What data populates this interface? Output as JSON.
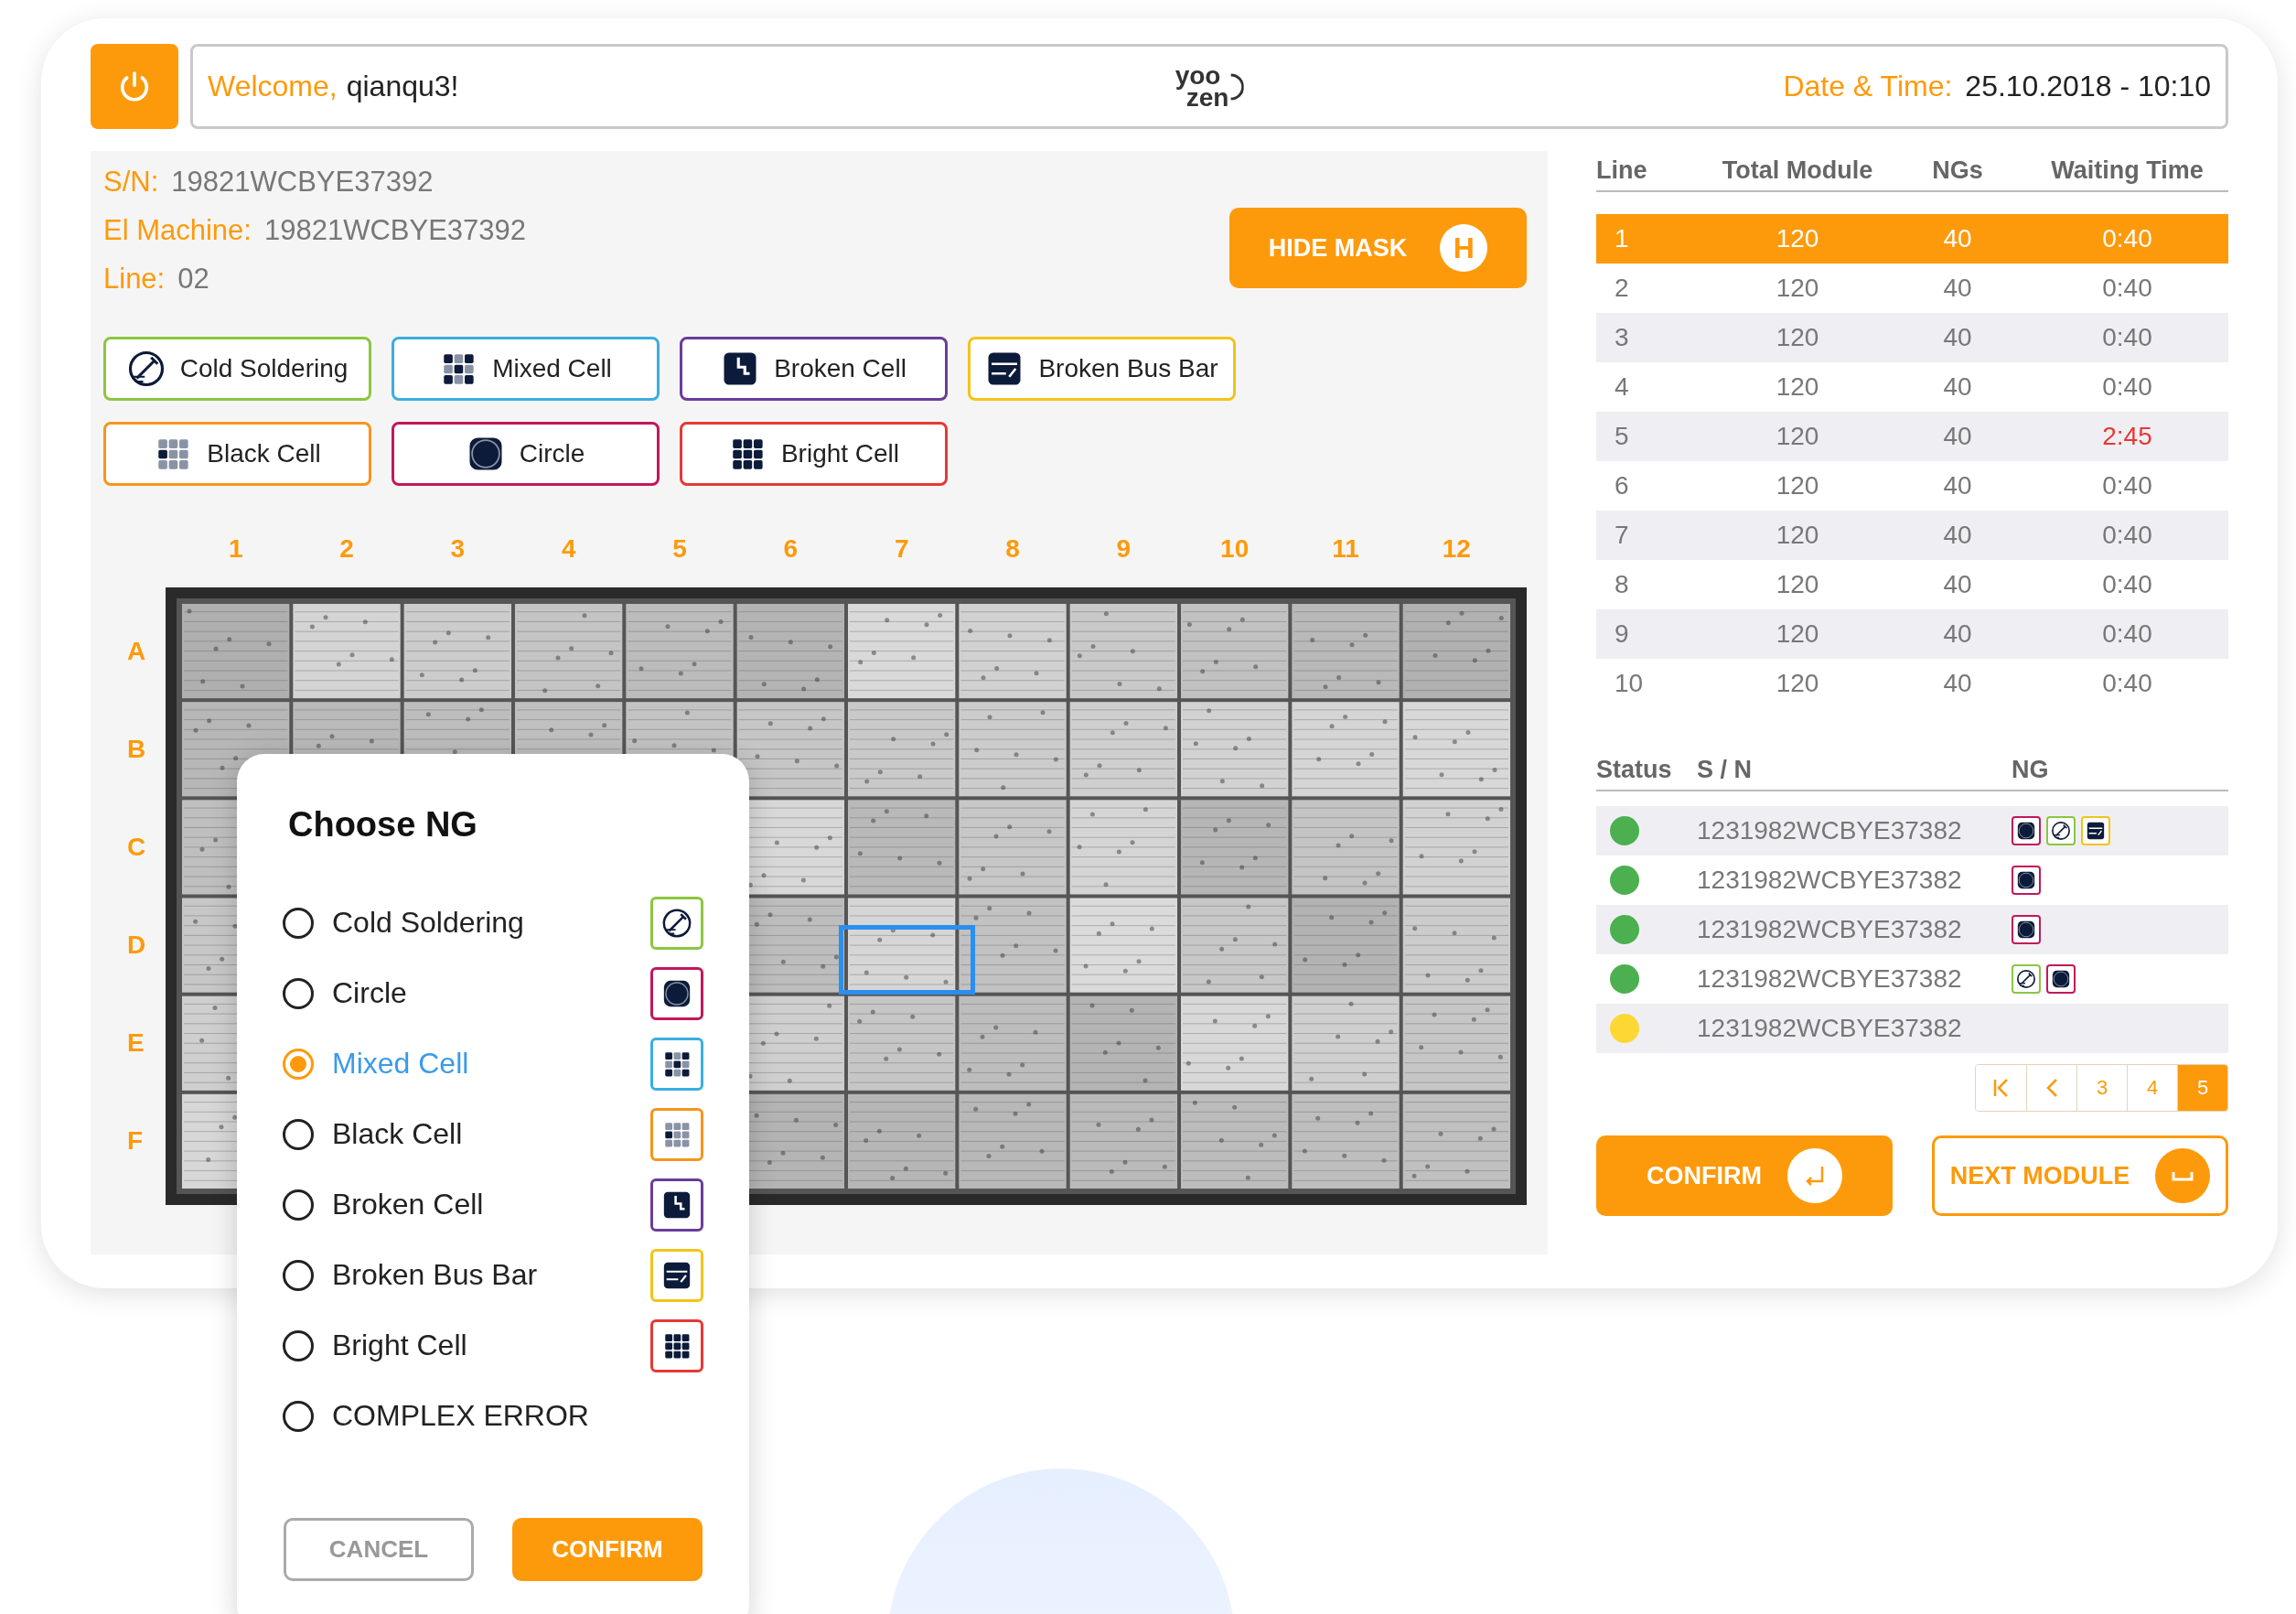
{
  "header": {
    "welcome_label": "Welcome,",
    "user": "qianqu3!",
    "logo_top": "yoo",
    "logo_bottom": "zen",
    "datetime_label": "Date & Time:",
    "datetime": "25.10.2018 - 10:10"
  },
  "info": [
    {
      "label": "S/N:",
      "value": "19821WCBYE37392"
    },
    {
      "label": "El Machine:",
      "value": "19821WCBYE37392"
    },
    {
      "label": "Line:",
      "value": "02"
    }
  ],
  "hide_mask": {
    "label": "HIDE MASK",
    "key": "H"
  },
  "defect_types": [
    {
      "kind": "cold-soldering",
      "label": "Cold Soldering",
      "color": "#8cc63f"
    },
    {
      "kind": "mixed-cell",
      "label": "Mixed Cell",
      "color": "#3aaee0"
    },
    {
      "kind": "broken-cell",
      "label": "Broken Cell",
      "color": "#6a3d9a"
    },
    {
      "kind": "broken-bus-bar",
      "label": "Broken Bus Bar",
      "color": "#f2c418"
    },
    {
      "kind": "black-cell",
      "label": "Black Cell",
      "color": "#f7941d"
    },
    {
      "kind": "circle",
      "label": "Circle",
      "color": "#c2185b"
    },
    {
      "kind": "bright-cell",
      "label": "Bright Cell",
      "color": "#e53935"
    }
  ],
  "grid": {
    "columns": [
      "1",
      "2",
      "3",
      "4",
      "5",
      "6",
      "7",
      "8",
      "9",
      "10",
      "11",
      "12"
    ],
    "rows": [
      "A",
      "B",
      "C",
      "D",
      "E",
      "F"
    ]
  },
  "lines_table": {
    "columns": [
      "Line",
      "Total Module",
      "NGs",
      "Waiting Time"
    ],
    "rows": [
      {
        "line": "1",
        "total": "120",
        "ngs": "40",
        "waiting": "0:40",
        "selected": true,
        "late": false
      },
      {
        "line": "2",
        "total": "120",
        "ngs": "40",
        "waiting": "0:40",
        "selected": false,
        "late": false
      },
      {
        "line": "3",
        "total": "120",
        "ngs": "40",
        "waiting": "0:40",
        "selected": false,
        "late": false
      },
      {
        "line": "4",
        "total": "120",
        "ngs": "40",
        "waiting": "0:40",
        "selected": false,
        "late": false
      },
      {
        "line": "5",
        "total": "120",
        "ngs": "40",
        "waiting": "2:45",
        "selected": false,
        "late": true
      },
      {
        "line": "6",
        "total": "120",
        "ngs": "40",
        "waiting": "0:40",
        "selected": false,
        "late": false
      },
      {
        "line": "7",
        "total": "120",
        "ngs": "40",
        "waiting": "0:40",
        "selected": false,
        "late": false
      },
      {
        "line": "8",
        "total": "120",
        "ngs": "40",
        "waiting": "0:40",
        "selected": false,
        "late": false
      },
      {
        "line": "9",
        "total": "120",
        "ngs": "40",
        "waiting": "0:40",
        "selected": false,
        "late": false
      },
      {
        "line": "10",
        "total": "120",
        "ngs": "40",
        "waiting": "0:40",
        "selected": false,
        "late": false
      }
    ]
  },
  "modules_table": {
    "columns": [
      "Status",
      "S / N",
      "NG"
    ],
    "rows": [
      {
        "color": "#4caf50",
        "sn": "1231982WCBYE37382",
        "ngs": [
          {
            "kind": "circle"
          },
          {
            "kind": "cold-soldering"
          },
          {
            "kind": "broken-bus-bar"
          }
        ]
      },
      {
        "color": "#4caf50",
        "sn": "1231982WCBYE37382",
        "ngs": [
          {
            "kind": "circle"
          }
        ]
      },
      {
        "color": "#4caf50",
        "sn": "1231982WCBYE37382",
        "ngs": [
          {
            "kind": "circle"
          }
        ]
      },
      {
        "color": "#4caf50",
        "sn": "1231982WCBYE37382",
        "ngs": [
          {
            "kind": "cold-soldering"
          },
          {
            "kind": "circle"
          }
        ]
      },
      {
        "color": "#fdd835",
        "sn": "1231982WCBYE37382",
        "ngs": []
      }
    ]
  },
  "pagination": [
    {
      "label": "3",
      "selected": false
    },
    {
      "label": "4",
      "selected": false
    },
    {
      "label": "5",
      "selected": true
    }
  ],
  "actions": {
    "confirm": "CONFIRM",
    "next": "NEXT MODULE"
  },
  "dialog": {
    "title": "Choose NG",
    "options": [
      {
        "kind": "cold-soldering",
        "label": "Cold Soldering",
        "selected": false
      },
      {
        "kind": "circle",
        "label": "Circle",
        "selected": false
      },
      {
        "kind": "mixed-cell",
        "label": "Mixed Cell",
        "selected": true
      },
      {
        "kind": "black-cell",
        "label": "Black Cell",
        "selected": false
      },
      {
        "kind": "broken-cell",
        "label": "Broken Cell",
        "selected": false
      },
      {
        "kind": "broken-bus-bar",
        "label": "Broken Bus Bar",
        "selected": false
      },
      {
        "kind": "bright-cell",
        "label": "Bright Cell",
        "selected": false
      },
      {
        "kind": "complex",
        "label": "COMPLEX ERROR",
        "selected": false
      }
    ],
    "cancel": "CANCEL",
    "confirm": "CONFIRM"
  }
}
